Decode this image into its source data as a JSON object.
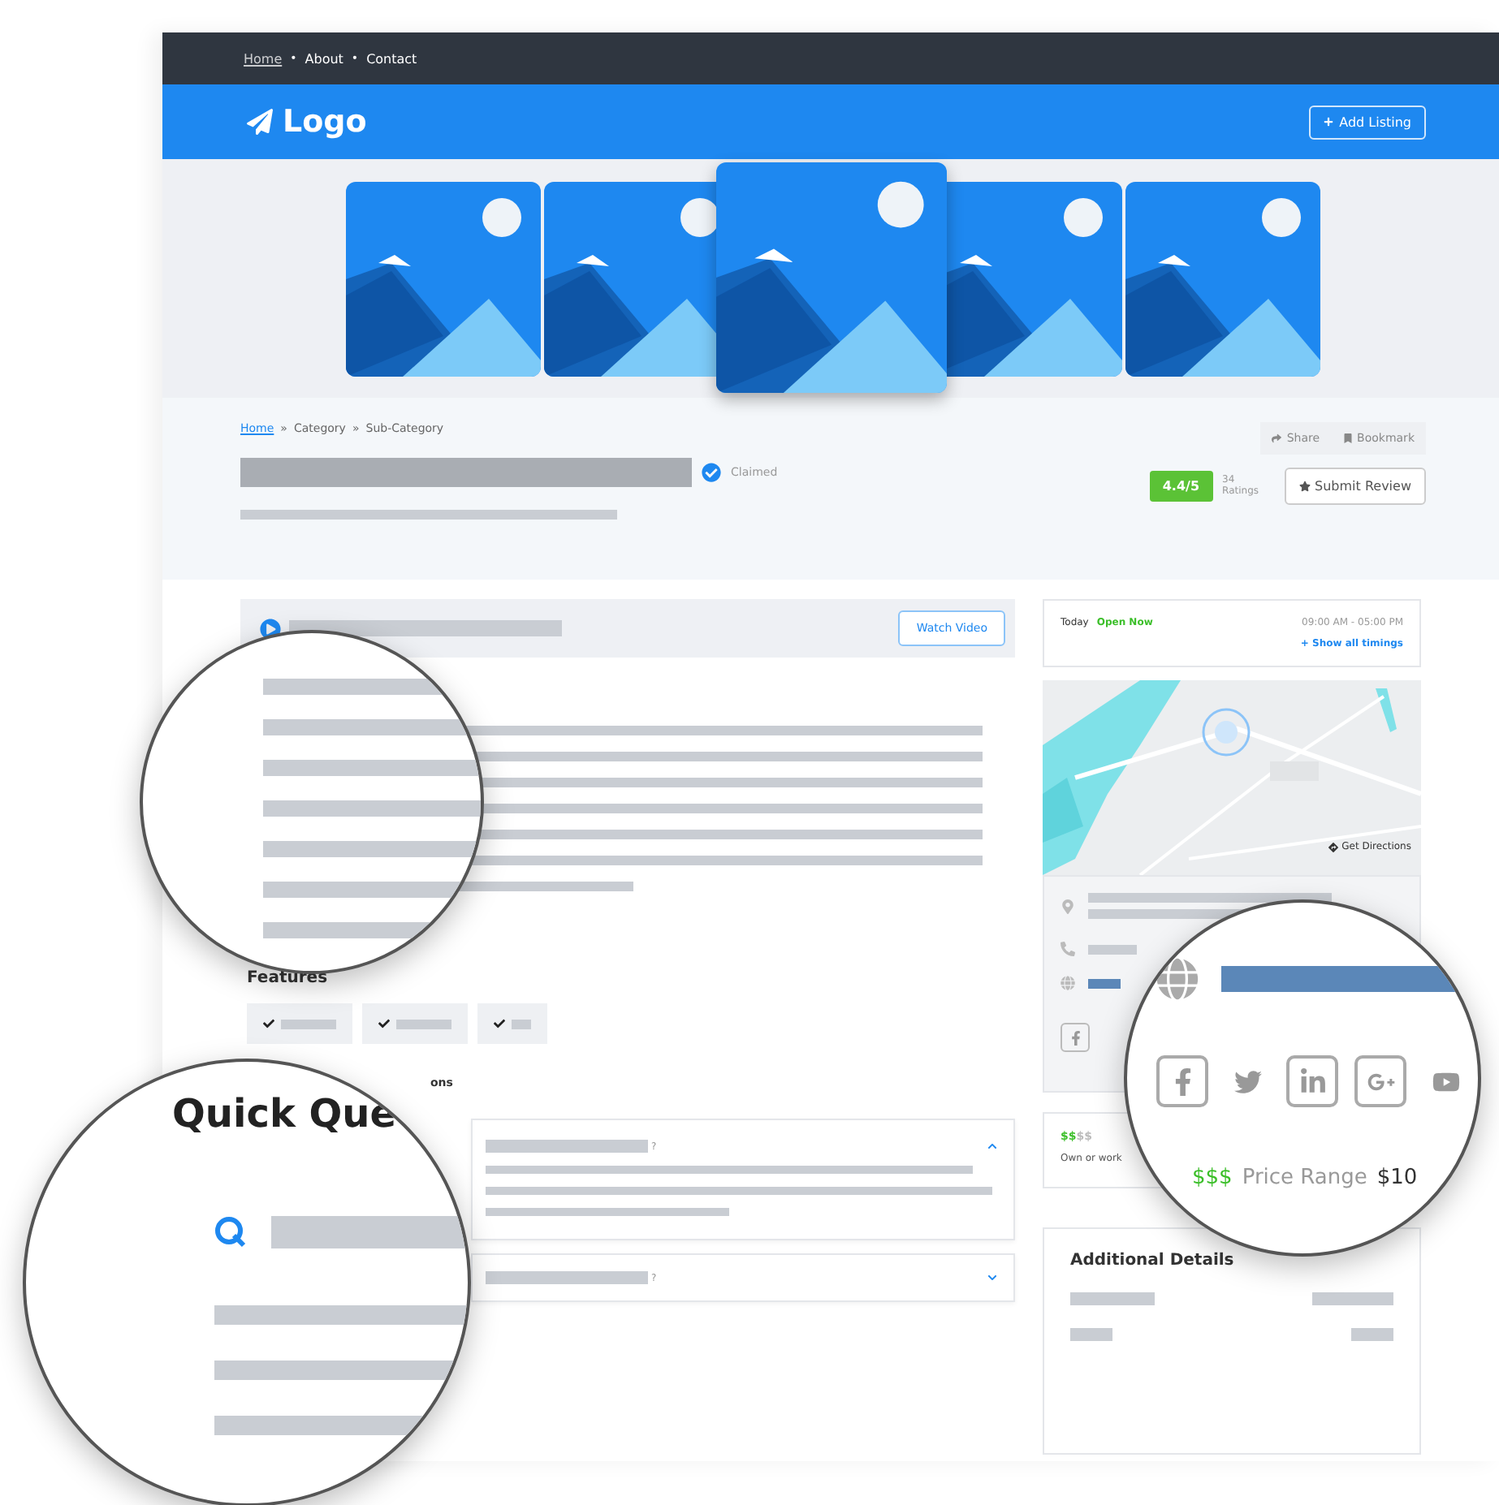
{
  "top_nav": {
    "separator": "•",
    "links": [
      {
        "label": "Home",
        "selected": true
      },
      {
        "label": "About",
        "selected": false
      },
      {
        "label": "Contact",
        "selected": false
      }
    ]
  },
  "header": {
    "logo": "Logo",
    "button": "Add Listing"
  },
  "gallery": {
    "images": [
      {
        "kind": "picture",
        "selected": false
      },
      {
        "kind": "picture",
        "selected": false
      },
      {
        "kind": "picture",
        "selected": true
      },
      {
        "kind": "picture",
        "selected": false
      },
      {
        "kind": "picture",
        "selected": false
      }
    ]
  },
  "listing": {
    "breadcrumb": [
      "Home",
      "Category",
      "Sub-Category"
    ],
    "breadcrumb_separator": "»",
    "claimed": "Claimed",
    "actions": [
      "Share",
      "Bookmark"
    ],
    "rating": "4.4/5",
    "ratings_count": "34",
    "ratings_label": "Ratings",
    "submit": "Submit Review"
  },
  "video": {
    "button": "Watch Video"
  },
  "features": {
    "title": "Features",
    "items": [
      {
        "checked": true
      },
      {
        "checked": true
      },
      {
        "checked": true
      }
    ]
  },
  "questions": {
    "magnified_title": "Quick Que",
    "title_tail": "ons",
    "items": [
      {
        "mark": "?",
        "expanded": true
      },
      {
        "mark": "?",
        "expanded": false
      }
    ]
  },
  "hours": {
    "day": "Today",
    "status": "Open Now",
    "time": "09:00 AM - 05:00 PM",
    "link": "+ Show all timings"
  },
  "map": {
    "directions": "Get Directions"
  },
  "price": {
    "symbols_active": "$$",
    "symbols_rest": "$$",
    "note": "Own or work",
    "magnified_symbols": "$$$",
    "magnified_label": "Price Range",
    "magnified_value": "$10"
  },
  "details": {
    "title": "Additional Details"
  }
}
